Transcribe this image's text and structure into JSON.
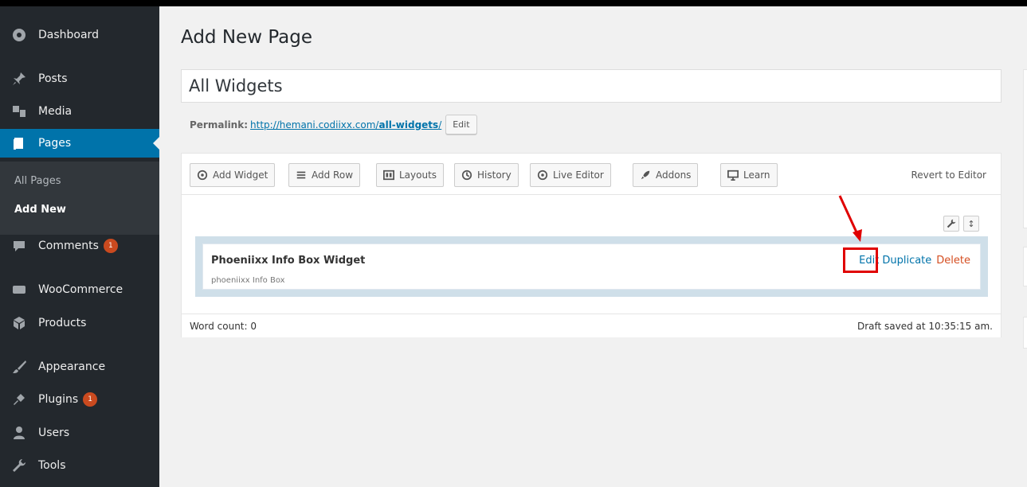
{
  "sidebar": {
    "items": [
      {
        "label": "Dashboard",
        "icon": "dashboard-icon"
      },
      {
        "label": "Posts",
        "icon": "pin-icon"
      },
      {
        "label": "Media",
        "icon": "media-icon"
      },
      {
        "label": "Pages",
        "icon": "pages-icon"
      },
      {
        "label": "Comments",
        "icon": "comment-icon",
        "badge": "1"
      },
      {
        "label": "WooCommerce",
        "icon": "woo-icon"
      },
      {
        "label": "Products",
        "icon": "cube-icon"
      },
      {
        "label": "Appearance",
        "icon": "brush-icon"
      },
      {
        "label": "Plugins",
        "icon": "plug-icon",
        "badge": "1"
      },
      {
        "label": "Users",
        "icon": "users-icon"
      },
      {
        "label": "Tools",
        "icon": "wrench-icon"
      }
    ],
    "submenu": [
      "All Pages",
      "Add New"
    ],
    "active_color": "#0073aa"
  },
  "main": {
    "title": "Add New Page",
    "post_title": "All Widgets",
    "permalink": {
      "label": "Permalink:",
      "url_base": "http://hemani.codiixx.com/",
      "url_slug": "all-widgets",
      "url_tail": "/",
      "edit_label": "Edit"
    }
  },
  "builder": {
    "toolbar": [
      "Add Widget",
      "Add Row",
      "Layouts",
      "History",
      "Live Editor",
      "Addons",
      "Learn"
    ],
    "revert_label": "Revert to Editor",
    "widget": {
      "title": "Phoeniixx Info Box Widget",
      "description": "phoeniixx Info Box",
      "edit_label": "Edit",
      "duplicate_label": "Duplicate",
      "delete_label": "Delete"
    },
    "word_count": "Word count: 0",
    "draft_status": "Draft saved at 10:35:15 am.",
    "highlight_color": "#e00000"
  }
}
